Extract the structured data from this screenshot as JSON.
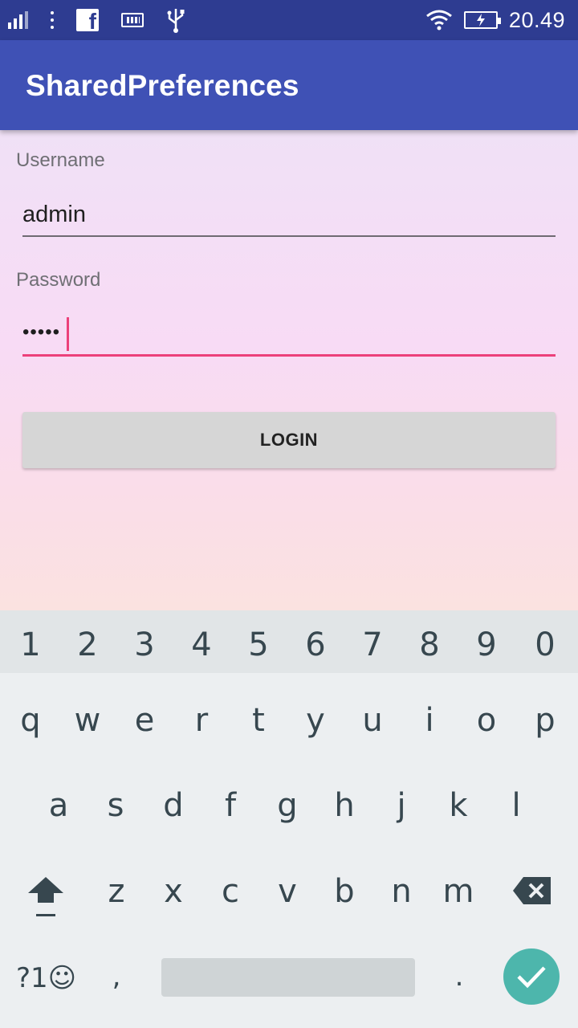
{
  "status_bar": {
    "time": "20.49"
  },
  "app_bar": {
    "title": "SharedPreferences"
  },
  "form": {
    "username_label": "Username",
    "username_value": "admin",
    "password_label": "Password",
    "password_value": "•••••",
    "login_label": "LOGIN"
  },
  "keyboard": {
    "number_row": [
      "1",
      "2",
      "3",
      "4",
      "5",
      "6",
      "7",
      "8",
      "9",
      "0"
    ],
    "row1": [
      "q",
      "w",
      "e",
      "r",
      "t",
      "y",
      "u",
      "i",
      "o",
      "p"
    ],
    "row2": [
      "a",
      "s",
      "d",
      "f",
      "g",
      "h",
      "j",
      "k",
      "l"
    ],
    "row3": [
      "z",
      "x",
      "c",
      "v",
      "b",
      "n",
      "m"
    ],
    "symbols_label": "?1☺",
    "comma": ",",
    "period": "."
  },
  "colors": {
    "status_bar": "#2e3c91",
    "app_bar": "#3f51b5",
    "accent": "#ec407a",
    "enter_key": "#4db6ac"
  }
}
